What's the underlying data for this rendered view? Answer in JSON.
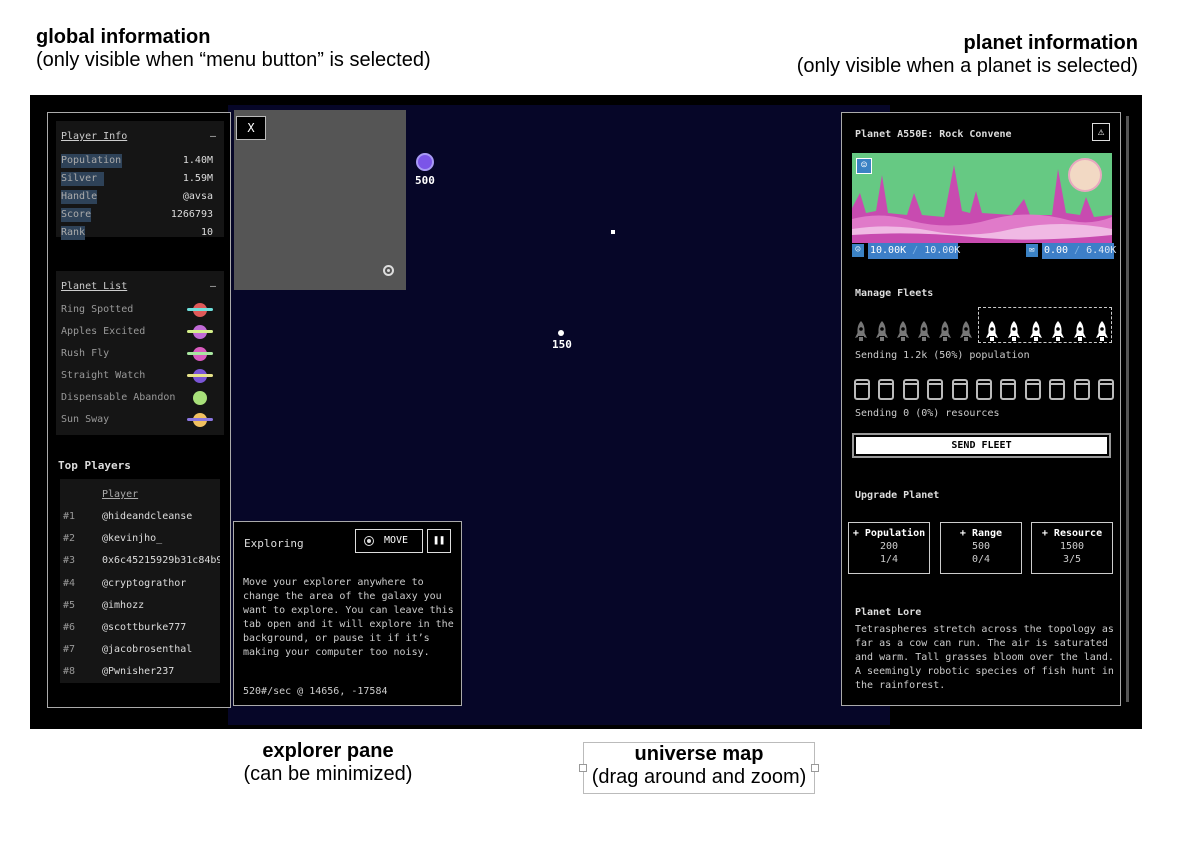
{
  "annotations": {
    "global_title": "global information",
    "global_sub": "(only visible when “menu button” is selected)",
    "planet_title": "planet information",
    "planet_sub": "(only visible when a planet is selected)",
    "explorer_title": "explorer pane",
    "explorer_sub": "(can be minimized)",
    "universe_title": "universe map",
    "universe_sub": "(drag around and zoom)"
  },
  "minimap": {
    "close_label": "X"
  },
  "map": {
    "planets": [
      {
        "label": "500",
        "color": "#7b55e8"
      },
      {
        "label": "150",
        "color": "#ffffff"
      }
    ]
  },
  "player_info": {
    "heading": "Player Info",
    "toggle": "–",
    "stats": [
      {
        "label": "Population",
        "value": "1.40M",
        "bar_fraction": 0.4
      },
      {
        "label": "Silver",
        "value": "1.59M",
        "bar_fraction": 0.28
      },
      {
        "label": "Handle",
        "value": "@avsa",
        "bar_fraction": 0.24
      },
      {
        "label": "Score",
        "value": "1266793",
        "bar_fraction": 0.2
      },
      {
        "label": "Rank",
        "value": "10",
        "bar_fraction": 0.16
      }
    ]
  },
  "planet_list": {
    "heading": "Planet List",
    "toggle": "–",
    "items": [
      {
        "label": "Ring Spotted",
        "icon": "planet-icon",
        "ball": "#e05a5a",
        "ring": "#6fe0dc"
      },
      {
        "label": "Apples Excited",
        "icon": "planet-icon",
        "ball": "#c06ad6",
        "ring": "#d4ef8a"
      },
      {
        "label": "Rush Fly",
        "icon": "planet-icon",
        "ball": "#d95bbf",
        "ring": "#a8e6a0"
      },
      {
        "label": "Straight Watch",
        "icon": "planet-icon",
        "ball": "#7a55d6",
        "ring": "#e8e38a"
      },
      {
        "label": "Dispensable Abandon",
        "icon": "planet-icon",
        "ball": "#a8e07a",
        "ring": ""
      },
      {
        "label": "Sun Sway",
        "icon": "planet-icon",
        "ball": "#f0c060",
        "ring": "#8a76e0"
      }
    ]
  },
  "top_players": {
    "heading": "Top Players",
    "column": "Player",
    "rows": [
      {
        "rank": "#1",
        "name": "@hideandcleanse"
      },
      {
        "rank": "#2",
        "name": "@kevinjho_"
      },
      {
        "rank": "#3",
        "name": "0x6c45215929b31c84b9"
      },
      {
        "rank": "#4",
        "name": "@cryptograthor"
      },
      {
        "rank": "#5",
        "name": "@imhozz"
      },
      {
        "rank": "#6",
        "name": "@scottburke777"
      },
      {
        "rank": "#7",
        "name": "@jacobrosenthal"
      },
      {
        "rank": "#8",
        "name": "@Pwnisher237"
      }
    ]
  },
  "explorer": {
    "title": "Exploring",
    "move_label": "MOVE",
    "pause_icon": "pause-icon",
    "pause_glyph": "❚❚",
    "description": "Move your explorer anywhere to change the area of the galaxy you want to explore. You can leave this tab open and it will explore in the background, or pause it if it’s making your computer too noisy.",
    "status": "520#/sec @ 14656, -17584"
  },
  "planet": {
    "title": "Planet A550E: Rock Convene",
    "warning_glyph": "⚠",
    "population_current": "10.00K",
    "population_max": "10.00K",
    "population_fraction": 1.0,
    "silver_current": "0.00",
    "silver_max": "6.40K",
    "silver_fraction": 0.0,
    "colors": {
      "sky": "#66c983",
      "terrain": "#c84bb0",
      "sun": "#f2d9c4",
      "accent": "#3d7fc8"
    }
  },
  "fleets": {
    "heading": "Manage Fleets",
    "rockets_total": 12,
    "rockets_selected": 6,
    "population_note": "Sending 1.2k (50%) population",
    "silos_total": 11,
    "resources_note": "Sending 0 (0%) resources",
    "send_label": "SEND FLEET"
  },
  "upgrade": {
    "heading": "Upgrade Planet",
    "options": [
      {
        "title": "+ Population",
        "cost": "200",
        "level": "1/4"
      },
      {
        "title": "+ Range",
        "cost": "500",
        "level": "0/4"
      },
      {
        "title": "+ Resource",
        "cost": "1500",
        "level": "3/5"
      }
    ]
  },
  "lore": {
    "heading": "Planet Lore",
    "text": "Tetraspheres stretch across the topology as far as a cow can run. The air is saturated and warm. Tall grasses bloom over the land. A seemingly robotic species of fish hunt in the rainforest."
  }
}
